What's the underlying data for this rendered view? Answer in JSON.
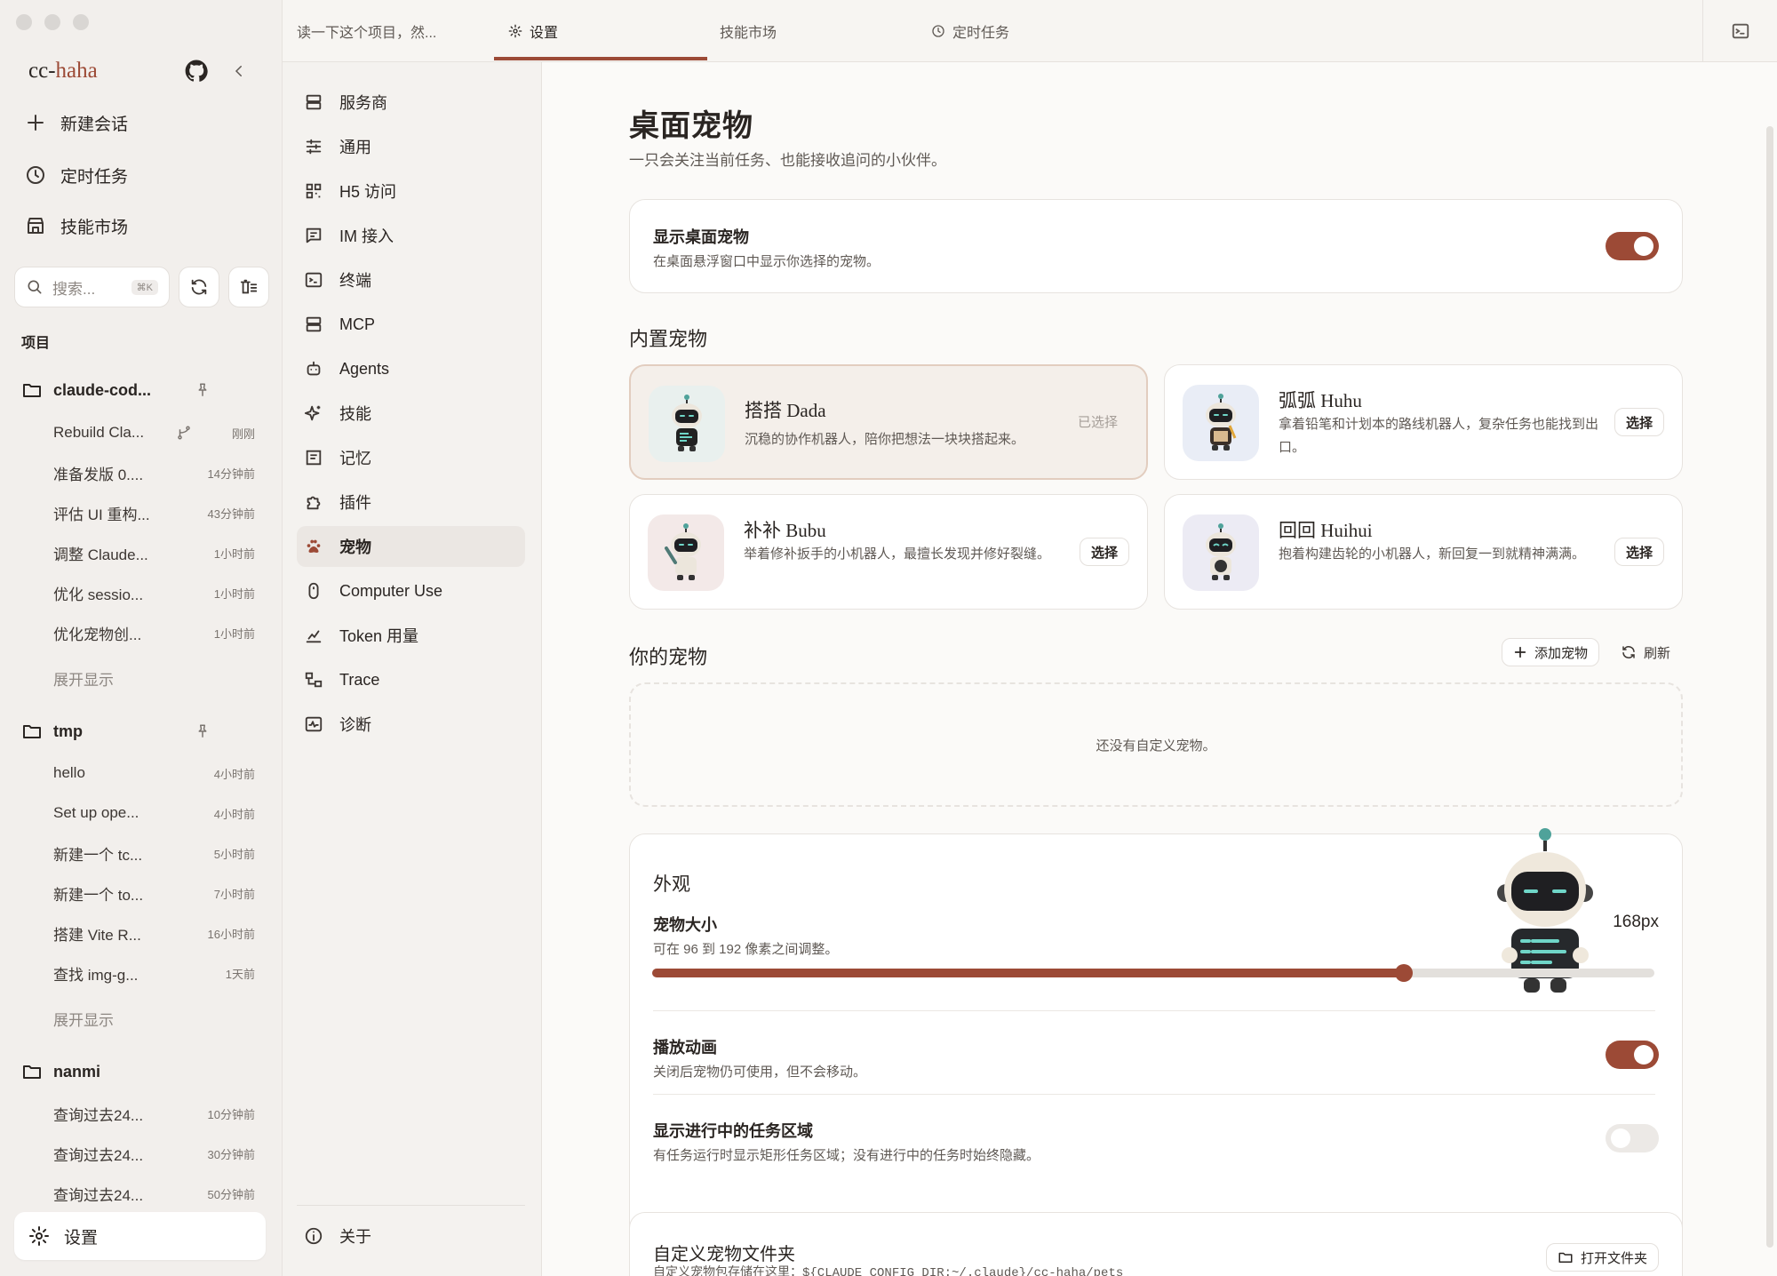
{
  "sidebar": {
    "brand_prefix": "cc-",
    "brand_suffix": "haha",
    "nav": {
      "new_chat": "新建会话",
      "scheduled": "定时任务",
      "skills": "技能市场"
    },
    "search": {
      "placeholder": "搜索...",
      "shortcut": "⌘K"
    },
    "section_label": "项目",
    "projects": [
      {
        "name": "claude-cod...",
        "conversations": [
          {
            "title": "Rebuild Cla...",
            "time": "刚刚"
          },
          {
            "title": "准备发版 0....",
            "time": "14分钟前"
          },
          {
            "title": "评估 UI 重构...",
            "time": "43分钟前"
          },
          {
            "title": "调整 Claude...",
            "time": "1小时前"
          },
          {
            "title": "优化 sessio...",
            "time": "1小时前"
          },
          {
            "title": "优化宠物创...",
            "time": "1小时前"
          }
        ],
        "expand": "展开显示"
      },
      {
        "name": "tmp",
        "conversations": [
          {
            "title": "hello",
            "time": "4小时前"
          },
          {
            "title": "Set up ope...",
            "time": "4小时前"
          },
          {
            "title": "新建一个 tc...",
            "time": "5小时前"
          },
          {
            "title": "新建一个 to...",
            "time": "7小时前"
          },
          {
            "title": "搭建 Vite R...",
            "time": "16小时前"
          },
          {
            "title": "查找 img-g...",
            "time": "1天前"
          }
        ],
        "expand": "展开显示"
      },
      {
        "name": "nanmi",
        "conversations": [
          {
            "title": "查询过去24...",
            "time": "10分钟前"
          },
          {
            "title": "查询过去24...",
            "time": "30分钟前"
          },
          {
            "title": "查询过去24...",
            "time": "50分钟前"
          }
        ]
      }
    ],
    "settings_label": "设置"
  },
  "tabs": [
    {
      "label": "读一下这个项目，然..."
    },
    {
      "label": "设置"
    },
    {
      "label": "技能市场"
    },
    {
      "label": "定时任务"
    }
  ],
  "settings_nav": [
    {
      "label": "服务商",
      "icon": "server-icon"
    },
    {
      "label": "通用",
      "icon": "sliders-icon"
    },
    {
      "label": "H5 访问",
      "icon": "qr-icon"
    },
    {
      "label": "IM 接入",
      "icon": "message-icon"
    },
    {
      "label": "终端",
      "icon": "terminal-icon"
    },
    {
      "label": "MCP",
      "icon": "server-icon"
    },
    {
      "label": "Agents",
      "icon": "robot-icon"
    },
    {
      "label": "技能",
      "icon": "sparkle-icon"
    },
    {
      "label": "记忆",
      "icon": "memory-icon"
    },
    {
      "label": "插件",
      "icon": "puzzle-icon"
    },
    {
      "label": "宠物",
      "icon": "paw-icon"
    },
    {
      "label": "Computer Use",
      "icon": "mouse-icon"
    },
    {
      "label": "Token 用量",
      "icon": "chart-icon"
    },
    {
      "label": "Trace",
      "icon": "trace-icon"
    },
    {
      "label": "诊断",
      "icon": "diagnose-icon"
    }
  ],
  "about_label": "关于",
  "page": {
    "title": "桌面宠物",
    "subtitle": "一只会关注当前任务、也能接收追问的小伙伴。",
    "show_pet": {
      "title": "显示桌面宠物",
      "desc": "在桌面悬浮窗口中显示你选择的宠物。",
      "on": true
    },
    "builtin_title": "内置宠物",
    "builtin": [
      {
        "name": "搭搭 Dada",
        "desc": "沉稳的协作机器人，陪你把想法一块块搭起来。",
        "status": "已选择",
        "selected": true
      },
      {
        "name": "弧弧 Huhu",
        "desc": "拿着铅笔和计划本的路线机器人，复杂任务也能找到出口。",
        "button": "选择"
      },
      {
        "name": "补补 Bubu",
        "desc": "举着修补扳手的小机器人，最擅长发现并修好裂缝。",
        "button": "选择"
      },
      {
        "name": "回回 Huihui",
        "desc": "抱着构建齿轮的小机器人，新回复一到就精神满满。",
        "button": "选择"
      }
    ],
    "yours_title": "你的宠物",
    "add_button": "添加宠物",
    "refresh_button": "刷新",
    "empty_text": "还没有自定义宠物。",
    "appearance": {
      "title": "外观",
      "size_title": "宠物大小",
      "size_desc": "可在 96 到 192 像素之间调整。",
      "size_value": "168px",
      "size_min": 96,
      "size_max": 192,
      "size_current": 168,
      "anim_title": "播放动画",
      "anim_desc": "关闭后宠物仍可使用，但不会移动。",
      "anim_on": true,
      "task_title": "显示进行中的任务区域",
      "task_desc": "有任务运行时显示矩形任务区域；没有进行中的任务时始终隐藏。",
      "task_on": false
    },
    "folder": {
      "title": "自定义宠物文件夹",
      "desc": "自定义宠物包存储在这里：${CLAUDE_CONFIG_DIR:~/.claude}/cc-haha/pets",
      "open_button": "打开文件夹"
    }
  },
  "colors": {
    "accent": "#9c4a36",
    "background": "#f7f5f2"
  }
}
